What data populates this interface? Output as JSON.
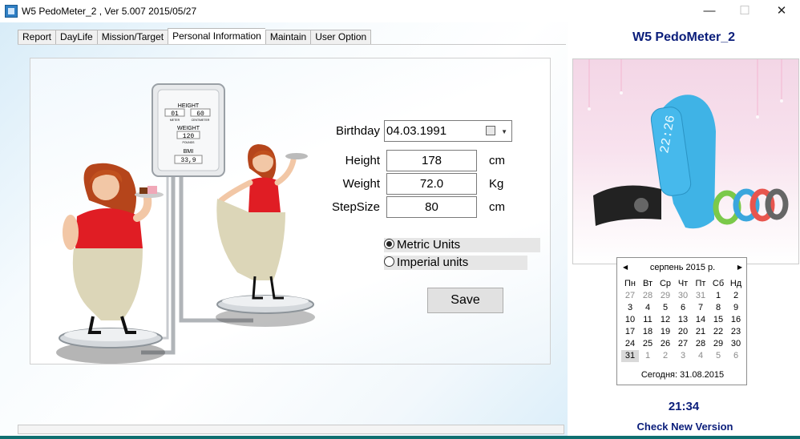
{
  "window": {
    "title": "W5  PedoMeter_2 , Ver 5.007  2015/05/27",
    "minimize": "—",
    "maximize": "☐",
    "close": "✕"
  },
  "tabs": [
    "Report",
    "DayLife",
    "Mission/Target",
    "Personal Information",
    "Maintain",
    "User Option"
  ],
  "active_tab": "Personal Information",
  "scale_display": {
    "height_label": "HEIGHT",
    "height_value_1": "01",
    "height_value_2": "60",
    "height_unit_1": "METER",
    "height_unit_2": "CENTIMETER",
    "weight_label": "WEIGHT",
    "weight_value": "120",
    "weight_unit": "POUNDS",
    "bmi_label": "BMI",
    "bmi_value": "33,9"
  },
  "form": {
    "birthday_label": "Birthday",
    "birthday_value": "04.03.1991",
    "height_label": "Height",
    "height_value": "178",
    "height_unit": "cm",
    "weight_label": "Weight",
    "weight_value": "72.0",
    "weight_unit": "Kg",
    "stepsize_label": "StepSize",
    "stepsize_value": "80",
    "stepsize_unit": "cm",
    "metric_label": "Metric  Units",
    "imperial_label": "Imperial units",
    "selected_units": "metric",
    "save_label": "Save"
  },
  "side": {
    "app_name": "W5  PedoMeter_2",
    "product_display": "22:26",
    "clock": "21:34",
    "check_label": "Check New Version"
  },
  "calendar": {
    "month_title": "серпень 2015 р.",
    "weekdays": [
      "Пн",
      "Вт",
      "Ср",
      "Чт",
      "Пт",
      "Сб",
      "Нд"
    ],
    "weeks": [
      [
        "27",
        "28",
        "29",
        "30",
        "31",
        "1",
        "2"
      ],
      [
        "3",
        "4",
        "5",
        "6",
        "7",
        "8",
        "9"
      ],
      [
        "10",
        "11",
        "12",
        "13",
        "14",
        "15",
        "16"
      ],
      [
        "17",
        "18",
        "19",
        "20",
        "21",
        "22",
        "23"
      ],
      [
        "24",
        "25",
        "26",
        "27",
        "28",
        "29",
        "30"
      ],
      [
        "31",
        "1",
        "2",
        "3",
        "4",
        "5",
        "6"
      ]
    ],
    "today_label": "Сегодня: 31.08.2015"
  },
  "colors": {
    "accent_navy": "#0a1d7a",
    "band_blue": "#3fb3e6",
    "dress_red": "#e01d24",
    "teal_strip": "#0f6f70"
  }
}
